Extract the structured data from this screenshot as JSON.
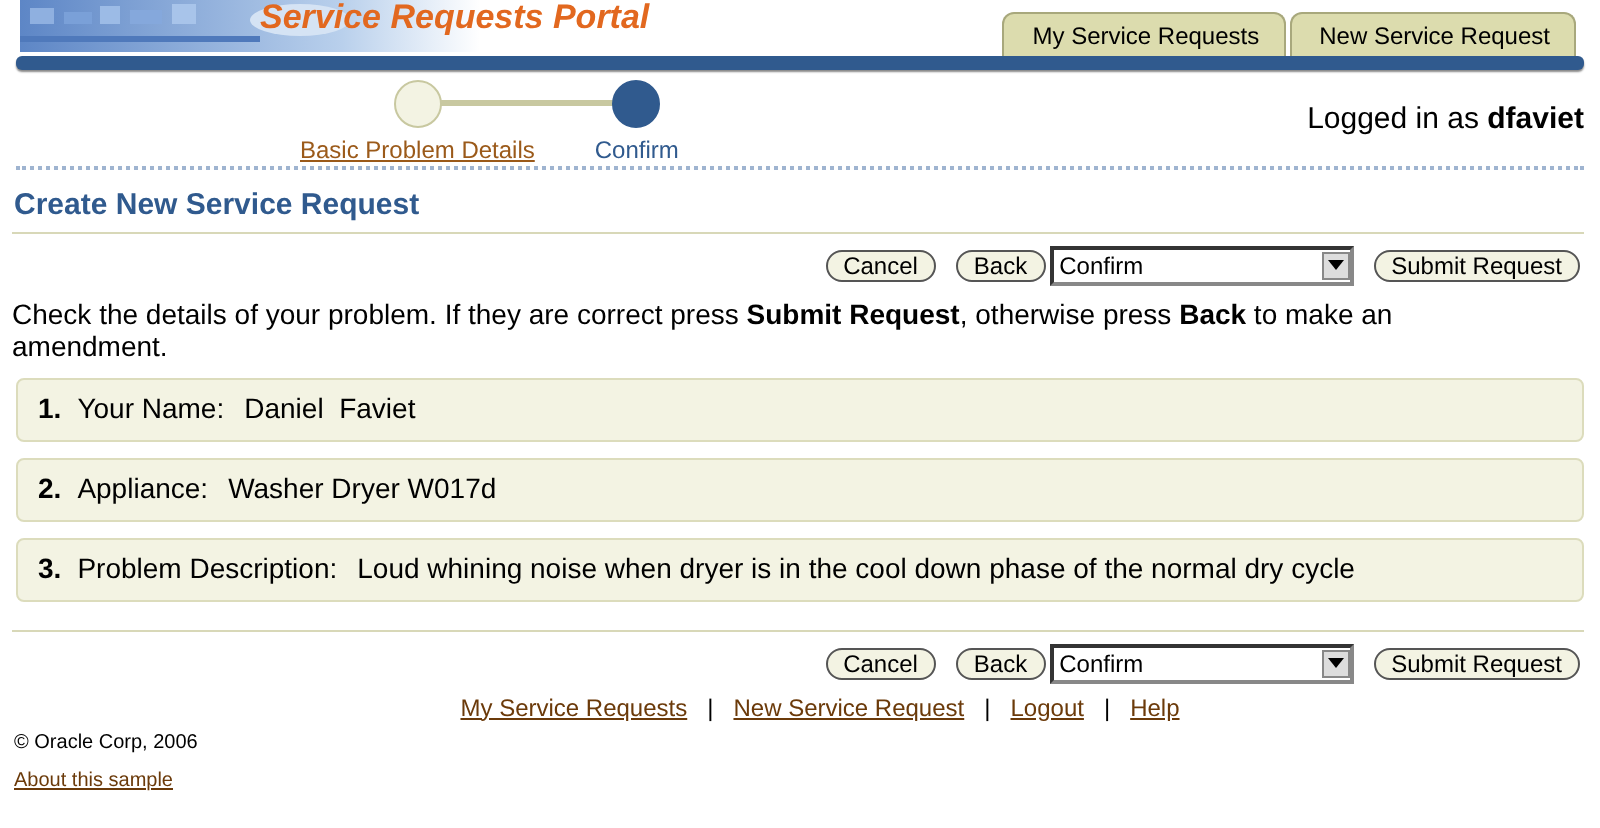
{
  "header": {
    "title": "Service Requests Portal"
  },
  "tabs": [
    {
      "label": "My Service Requests",
      "selected": false
    },
    {
      "label": "New Service Request",
      "selected": false
    }
  ],
  "train": [
    {
      "label": "Basic Problem Details",
      "selected": false
    },
    {
      "label": "Confirm",
      "selected": true
    }
  ],
  "user": {
    "text": "Logged in as **dfaviet**"
  },
  "page_title": "Create New Service Request",
  "top_actions": {
    "cancel": "Cancel",
    "back": "Back",
    "choice": "Confirm",
    "submit": "Submit Request"
  },
  "instructions": "Check the details of your problem. If they are correct press **Submit Request**, otherwise press **Back** to make an amendment.",
  "details": [
    {
      "number": "1.",
      "label": "Your Name:",
      "value": "Daniel  Faviet"
    },
    {
      "number": "2.",
      "label": "Appliance:",
      "value": "Washer Dryer W017d"
    },
    {
      "number": "3.",
      "label": "Problem Description:",
      "value": "Loud whining noise when dryer is in the cool down phase of the normal dry cycle"
    }
  ],
  "bottom_actions": {
    "cancel": "Cancel",
    "back": "Back",
    "choice": "Confirm",
    "submit": "Submit Request"
  },
  "footer_links": [
    "My Service Requests",
    "New Service Request",
    "Logout",
    "Help"
  ],
  "footer_separators": [
    "|",
    "|",
    "|"
  ],
  "copyright": "© Oracle Corp, 2006",
  "about_link": "About this sample"
}
